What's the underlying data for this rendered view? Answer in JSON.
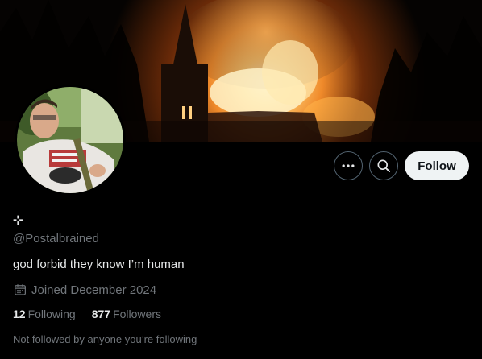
{
  "profile": {
    "display_name": "⊹",
    "handle": "@Postalbrained",
    "bio": "god forbid they know I’m human",
    "joined": "Joined December 2024",
    "following_count": "12",
    "following_label": "Following",
    "followers_count": "877",
    "followers_label": "Followers",
    "not_followed_text": "Not followed by anyone you’re following"
  },
  "actions": {
    "more_icon": "more-icon",
    "search_icon": "search-icon",
    "follow_label": "Follow"
  },
  "banner": {
    "icon": "banner-image"
  },
  "avatar": {
    "icon": "avatar-image"
  },
  "colors": {
    "background": "#000000",
    "text_primary": "#e7e9ea",
    "text_secondary": "#71767b",
    "follow_button_bg": "#eff3f4",
    "follow_button_text": "#0f1419",
    "button_border": "#536471"
  }
}
